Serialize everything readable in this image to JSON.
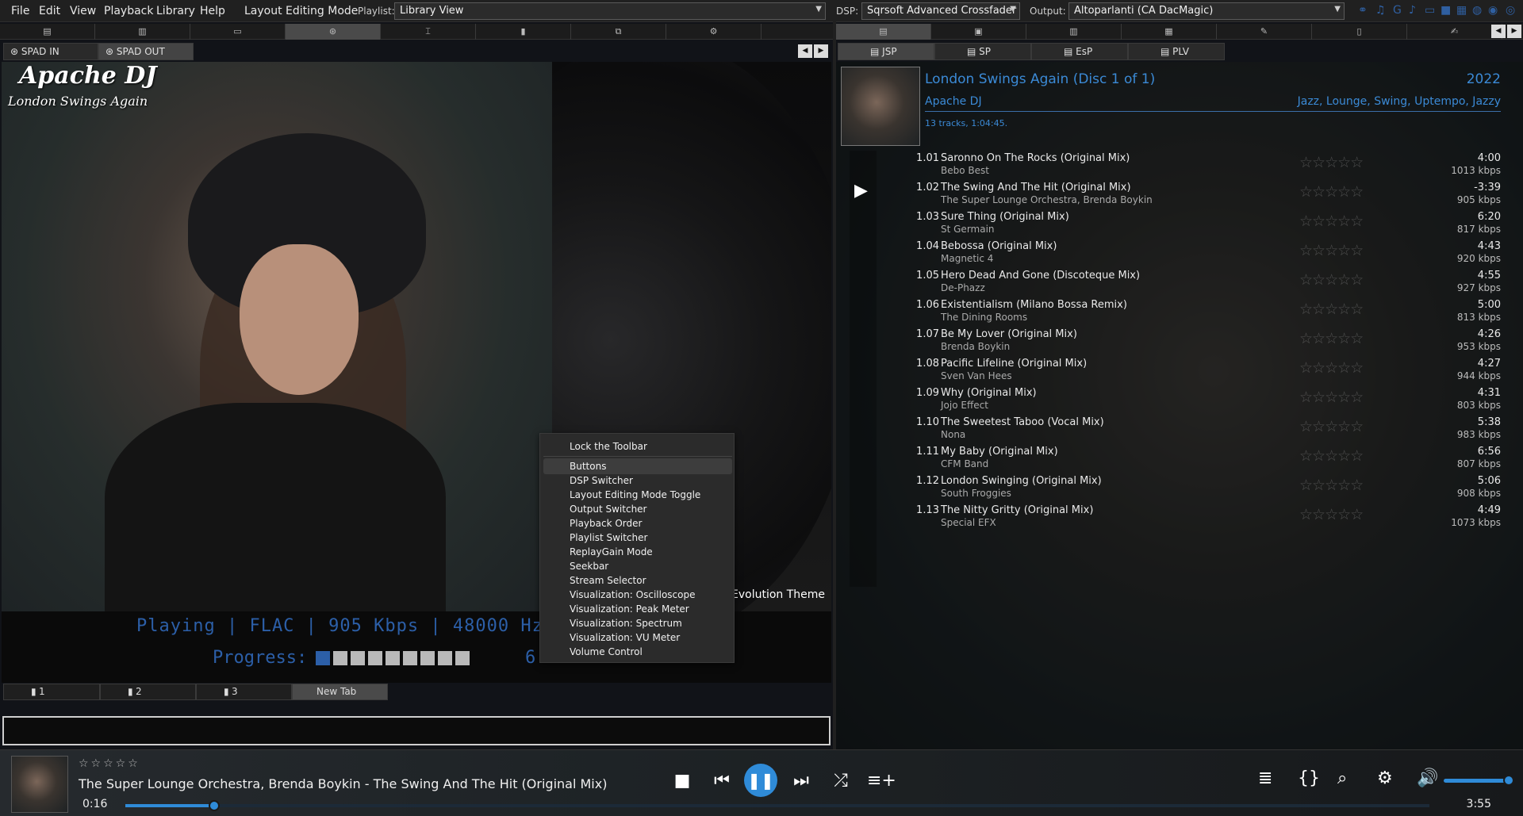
{
  "menu": {
    "items": [
      "File",
      "Edit",
      "View",
      "Playback",
      "Library",
      "Help"
    ],
    "layout_mode": "Layout Editing Mode"
  },
  "playlist_label": "Playlist:",
  "playlist_value": "Library View",
  "dsp_label": "DSP:",
  "dsp_value": "Sqrsoft Advanced Crossfader",
  "output_label": "Output:",
  "output_value": "Altoparlanti (CA DacMagic)",
  "left_tabs": [
    "SPAD IN",
    "SPAD OUT"
  ],
  "right_tabs": [
    "JSP",
    "SP",
    "EsP",
    "PLV"
  ],
  "art": {
    "title": "Apache DJ",
    "subtitle": "London Swings Again",
    "theme_text": "Evolution Theme"
  },
  "status": {
    "playing": "Playing | FLAC | 905 Kbps | 48000 Hz | Stereo",
    "progress_label": "Progress:",
    "progress_percent": "6 %",
    "progress_value": 6
  },
  "bottom_tabs": [
    "1",
    "2",
    "3",
    "New Tab"
  ],
  "album": {
    "title": "London Swings Again (Disc 1 of 1)",
    "year": "2022",
    "artist": "Apache DJ",
    "genres": "Jazz, Lounge, Swing, Uptempo, Jazzy",
    "info": "13 tracks, 1:04:45."
  },
  "tracks": [
    {
      "num": "1.01",
      "title": "Saronno On The Rocks (Original Mix)",
      "artist": "Bebo Best",
      "length": "4:00",
      "kbps": "1013 kbps"
    },
    {
      "num": "1.02",
      "title": "The Swing And The Hit (Original Mix)",
      "artist": "The Super Lounge Orchestra, Brenda Boykin",
      "length": "-3:39",
      "kbps": "905 kbps"
    },
    {
      "num": "1.03",
      "title": "Sure Thing (Original Mix)",
      "artist": "St Germain",
      "length": "6:20",
      "kbps": "817 kbps"
    },
    {
      "num": "1.04",
      "title": "Bebossa (Original Mix)",
      "artist": "Magnetic 4",
      "length": "4:43",
      "kbps": "920 kbps"
    },
    {
      "num": "1.05",
      "title": "Hero Dead And Gone (Discoteque Mix)",
      "artist": "De-Phazz",
      "length": "4:55",
      "kbps": "927 kbps"
    },
    {
      "num": "1.06",
      "title": "Existentialism (Milano Bossa Remix)",
      "artist": "The Dining Rooms",
      "length": "5:00",
      "kbps": "813 kbps"
    },
    {
      "num": "1.07",
      "title": "Be My Lover (Original Mix)",
      "artist": "Brenda Boykin",
      "length": "4:26",
      "kbps": "953 kbps"
    },
    {
      "num": "1.08",
      "title": "Pacific Lifeline (Original Mix)",
      "artist": "Sven Van Hees",
      "length": "4:27",
      "kbps": "944 kbps"
    },
    {
      "num": "1.09",
      "title": "Why (Original Mix)",
      "artist": "Jojo Effect",
      "length": "4:31",
      "kbps": "803 kbps"
    },
    {
      "num": "1.10",
      "title": "The Sweetest Taboo (Vocal Mix)",
      "artist": "Nona",
      "length": "5:38",
      "kbps": "983 kbps"
    },
    {
      "num": "1.11",
      "title": "My Baby (Original Mix)",
      "artist": "CFM Band",
      "length": "6:56",
      "kbps": "807 kbps"
    },
    {
      "num": "1.12",
      "title": "London Swinging (Original Mix)",
      "artist": "South Froggies",
      "length": "5:06",
      "kbps": "908 kbps"
    },
    {
      "num": "1.13",
      "title": "The Nitty Gritty (Original Mix)",
      "artist": "Special EFX",
      "length": "4:49",
      "kbps": "1073 kbps"
    }
  ],
  "context_menu": [
    "Lock the Toolbar",
    "Buttons",
    "DSP Switcher",
    "Layout Editing Mode Toggle",
    "Output Switcher",
    "Playback Order",
    "Playlist Switcher",
    "ReplayGain Mode",
    "Seekbar",
    "Stream Selector",
    "Visualization: Oscilloscope",
    "Visualization: Peak Meter",
    "Visualization: Spectrum",
    "Visualization: VU Meter",
    "Volume Control"
  ],
  "player": {
    "now_playing": "The Super Lounge Orchestra, Brenda Boykin - The Swing And The Hit (Original Mix)",
    "elapsed": "0:16",
    "duration": "3:55",
    "seek_fraction": 0.068,
    "volume_fraction": 1.0,
    "rating_stars": "☆☆☆☆☆"
  },
  "colors": {
    "accent": "#2f8bd8",
    "status_text": "#2c5fa8",
    "album_header": "#3b8ad6"
  }
}
